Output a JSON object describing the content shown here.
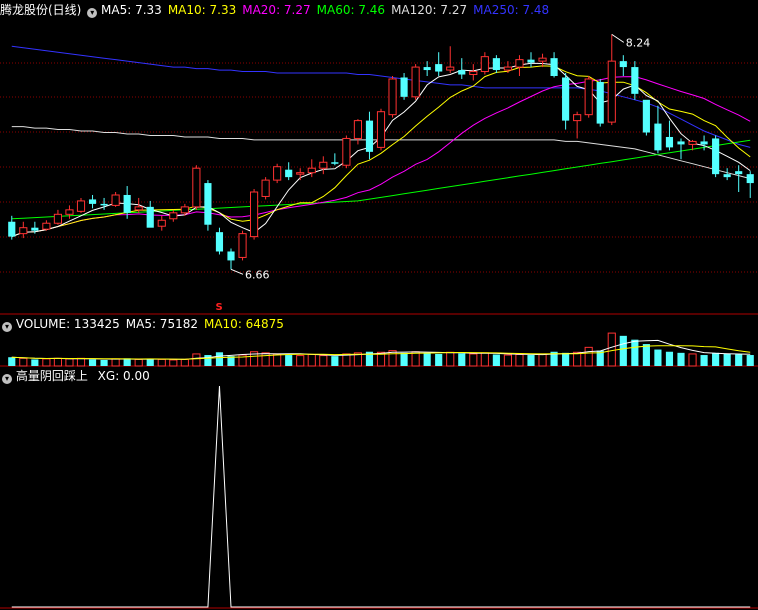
{
  "header": {
    "stock": "腾龙股份(日线)",
    "ma_items": [
      {
        "text": "MA5: 7.33",
        "color": "#ffffff"
      },
      {
        "text": "MA10: 7.33",
        "color": "#ffff00"
      },
      {
        "text": "MA20: 7.27",
        "color": "#ff00ff"
      },
      {
        "text": "MA60: 7.46",
        "color": "#00ff00"
      },
      {
        "text": "MA120: 7.27",
        "color": "#dddddd"
      },
      {
        "text": "MA250: 7.48",
        "color": "#3333ff"
      }
    ]
  },
  "volume_header": {
    "items": [
      {
        "text": "VOLUME: 133425",
        "color": "#ffffff"
      },
      {
        "text": "MA5: 75182",
        "color": "#ffffff"
      },
      {
        "text": "MA10: 64875",
        "color": "#ffff00"
      }
    ]
  },
  "indicator_header": {
    "name": "高量阴回踩上",
    "value": "XG: 0.00"
  },
  "colors": {
    "up": "#ff3232",
    "down": "#54ffff",
    "ma5": "#ffffff",
    "ma10": "#ffff00",
    "ma20": "#ff00ff",
    "ma60": "#00ff00",
    "ma120": "#dddddd",
    "ma250": "#3333ff",
    "grid": "#8b0000"
  },
  "chart_data": {
    "type": "candlestick",
    "price_axis": {
      "min": 6.4,
      "max": 8.35
    },
    "annotations": [
      {
        "text": "8.24",
        "kind": "high"
      },
      {
        "text": "6.66",
        "kind": "low"
      },
      {
        "text": "S",
        "kind": "signal",
        "index": 18
      }
    ],
    "candles": [
      {
        "o": 6.98,
        "h": 7.02,
        "l": 6.86,
        "c": 6.88
      },
      {
        "o": 6.9,
        "h": 6.98,
        "l": 6.87,
        "c": 6.94
      },
      {
        "o": 6.94,
        "h": 6.98,
        "l": 6.9,
        "c": 6.92
      },
      {
        "o": 6.93,
        "h": 6.99,
        "l": 6.92,
        "c": 6.97
      },
      {
        "o": 6.97,
        "h": 7.06,
        "l": 6.96,
        "c": 7.03
      },
      {
        "o": 7.03,
        "h": 7.09,
        "l": 7.0,
        "c": 7.06
      },
      {
        "o": 7.05,
        "h": 7.14,
        "l": 7.04,
        "c": 7.12
      },
      {
        "o": 7.13,
        "h": 7.16,
        "l": 7.07,
        "c": 7.1
      },
      {
        "o": 7.1,
        "h": 7.14,
        "l": 7.06,
        "c": 7.09
      },
      {
        "o": 7.09,
        "h": 7.18,
        "l": 7.08,
        "c": 7.16
      },
      {
        "o": 7.16,
        "h": 7.22,
        "l": 7.0,
        "c": 7.04
      },
      {
        "o": 7.06,
        "h": 7.14,
        "l": 7.04,
        "c": 7.08
      },
      {
        "o": 7.08,
        "h": 7.12,
        "l": 7.0,
        "c": 6.94
      },
      {
        "o": 6.95,
        "h": 7.02,
        "l": 6.92,
        "c": 6.99
      },
      {
        "o": 7.0,
        "h": 7.06,
        "l": 6.98,
        "c": 7.04
      },
      {
        "o": 7.04,
        "h": 7.1,
        "l": 7.02,
        "c": 7.08
      },
      {
        "o": 7.08,
        "h": 7.36,
        "l": 7.06,
        "c": 7.34
      },
      {
        "o": 7.24,
        "h": 7.26,
        "l": 6.92,
        "c": 6.96
      },
      {
        "o": 6.91,
        "h": 6.94,
        "l": 6.76,
        "c": 6.78
      },
      {
        "o": 6.78,
        "h": 6.8,
        "l": 6.66,
        "c": 6.72
      },
      {
        "o": 6.74,
        "h": 6.92,
        "l": 6.72,
        "c": 6.9
      },
      {
        "o": 6.88,
        "h": 7.2,
        "l": 6.86,
        "c": 7.18
      },
      {
        "o": 7.15,
        "h": 7.28,
        "l": 7.13,
        "c": 7.26
      },
      {
        "o": 7.26,
        "h": 7.37,
        "l": 7.24,
        "c": 7.35
      },
      {
        "o": 7.33,
        "h": 7.38,
        "l": 7.26,
        "c": 7.28
      },
      {
        "o": 7.3,
        "h": 7.34,
        "l": 7.26,
        "c": 7.31
      },
      {
        "o": 7.31,
        "h": 7.4,
        "l": 7.28,
        "c": 7.34
      },
      {
        "o": 7.34,
        "h": 7.42,
        "l": 7.3,
        "c": 7.38
      },
      {
        "o": 7.38,
        "h": 7.44,
        "l": 7.36,
        "c": 7.37
      },
      {
        "o": 7.36,
        "h": 7.56,
        "l": 7.34,
        "c": 7.54
      },
      {
        "o": 7.54,
        "h": 7.67,
        "l": 7.5,
        "c": 7.66
      },
      {
        "o": 7.66,
        "h": 7.72,
        "l": 7.4,
        "c": 7.45
      },
      {
        "o": 7.48,
        "h": 7.74,
        "l": 7.46,
        "c": 7.72
      },
      {
        "o": 7.7,
        "h": 7.96,
        "l": 7.68,
        "c": 7.94
      },
      {
        "o": 7.95,
        "h": 7.98,
        "l": 7.8,
        "c": 7.82
      },
      {
        "o": 7.82,
        "h": 8.04,
        "l": 7.8,
        "c": 8.02
      },
      {
        "o": 8.02,
        "h": 8.06,
        "l": 7.96,
        "c": 8.0
      },
      {
        "o": 8.04,
        "h": 8.12,
        "l": 7.96,
        "c": 7.99
      },
      {
        "o": 8.0,
        "h": 8.16,
        "l": 7.98,
        "c": 8.02
      },
      {
        "o": 8.0,
        "h": 8.08,
        "l": 7.94,
        "c": 7.97
      },
      {
        "o": 7.97,
        "h": 8.04,
        "l": 7.93,
        "c": 7.99
      },
      {
        "o": 7.99,
        "h": 8.12,
        "l": 7.97,
        "c": 8.09
      },
      {
        "o": 8.08,
        "h": 8.1,
        "l": 7.98,
        "c": 8.0
      },
      {
        "o": 8.0,
        "h": 8.06,
        "l": 7.98,
        "c": 8.02
      },
      {
        "o": 8.02,
        "h": 8.1,
        "l": 7.96,
        "c": 8.07
      },
      {
        "o": 8.07,
        "h": 8.12,
        "l": 8.02,
        "c": 8.05
      },
      {
        "o": 8.06,
        "h": 8.11,
        "l": 8.02,
        "c": 8.08
      },
      {
        "o": 8.08,
        "h": 8.12,
        "l": 7.95,
        "c": 7.96
      },
      {
        "o": 7.95,
        "h": 7.98,
        "l": 7.6,
        "c": 7.66
      },
      {
        "o": 7.66,
        "h": 7.72,
        "l": 7.54,
        "c": 7.7
      },
      {
        "o": 7.7,
        "h": 7.96,
        "l": 7.68,
        "c": 7.94
      },
      {
        "o": 7.92,
        "h": 7.94,
        "l": 7.62,
        "c": 7.64
      },
      {
        "o": 7.65,
        "h": 8.24,
        "l": 7.63,
        "c": 8.06
      },
      {
        "o": 8.06,
        "h": 8.1,
        "l": 7.96,
        "c": 8.02
      },
      {
        "o": 8.02,
        "h": 8.06,
        "l": 7.8,
        "c": 7.84
      },
      {
        "o": 7.8,
        "h": 7.78,
        "l": 7.56,
        "c": 7.58
      },
      {
        "o": 7.64,
        "h": 7.76,
        "l": 7.44,
        "c": 7.46
      },
      {
        "o": 7.55,
        "h": 7.66,
        "l": 7.46,
        "c": 7.48
      },
      {
        "o": 7.52,
        "h": 7.54,
        "l": 7.4,
        "c": 7.5
      },
      {
        "o": 7.5,
        "h": 7.53,
        "l": 7.46,
        "c": 7.52
      },
      {
        "o": 7.52,
        "h": 7.56,
        "l": 7.46,
        "c": 7.5
      },
      {
        "o": 7.54,
        "h": 7.56,
        "l": 7.28,
        "c": 7.3
      },
      {
        "o": 7.3,
        "h": 7.34,
        "l": 7.26,
        "c": 7.28
      },
      {
        "o": 7.32,
        "h": 7.36,
        "l": 7.18,
        "c": 7.3
      },
      {
        "o": 7.3,
        "h": 7.32,
        "l": 7.14,
        "c": 7.24
      }
    ],
    "volume": [
      16,
      14,
      12,
      13,
      14,
      13,
      14,
      12,
      11,
      13,
      14,
      12,
      13,
      12,
      11,
      12,
      22,
      20,
      25,
      18,
      20,
      26,
      24,
      22,
      20,
      19,
      21,
      19,
      18,
      22,
      24,
      26,
      25,
      28,
      24,
      26,
      24,
      22,
      25,
      23,
      22,
      24,
      21,
      20,
      21,
      20,
      22,
      26,
      24,
      25,
      34,
      28,
      60,
      55,
      48,
      40,
      30,
      26,
      24,
      22,
      20,
      24,
      22,
      21,
      20
    ],
    "xg": [
      0,
      0,
      0,
      0,
      0,
      0,
      0,
      0,
      0,
      0,
      0,
      0,
      0,
      0,
      0,
      0,
      0,
      0,
      1,
      0,
      0,
      0,
      0,
      0,
      0,
      0,
      0,
      0,
      0,
      0,
      0,
      0,
      0,
      0,
      0,
      0,
      0,
      0,
      0,
      0,
      0,
      0,
      0,
      0,
      0,
      0,
      0,
      0,
      0,
      0,
      0,
      0,
      0,
      0,
      0,
      0,
      0,
      0,
      0,
      0,
      0,
      0,
      0,
      0,
      0
    ],
    "ma120": [
      7.62,
      7.62,
      7.61,
      7.61,
      7.6,
      7.6,
      7.59,
      7.59,
      7.58,
      7.58,
      7.57,
      7.57,
      7.56,
      7.56,
      7.56,
      7.55,
      7.55,
      7.55,
      7.54,
      7.54,
      7.54,
      7.53,
      7.53,
      7.53,
      7.53,
      7.53,
      7.53,
      7.53,
      7.53,
      7.53,
      7.53,
      7.53,
      7.53,
      7.53,
      7.53,
      7.53,
      7.53,
      7.53,
      7.53,
      7.53,
      7.53,
      7.53,
      7.53,
      7.53,
      7.53,
      7.53,
      7.53,
      7.53,
      7.52,
      7.52,
      7.51,
      7.5,
      7.49,
      7.48,
      7.47,
      7.45,
      7.43,
      7.41,
      7.39,
      7.37,
      7.35,
      7.33,
      7.31,
      7.29,
      7.27
    ],
    "ma250": [
      8.16,
      8.15,
      8.14,
      8.13,
      8.12,
      8.11,
      8.1,
      8.09,
      8.08,
      8.07,
      8.06,
      8.05,
      8.04,
      8.03,
      8.02,
      8.02,
      8.01,
      8.01,
      8.0,
      8.0,
      7.99,
      7.99,
      7.99,
      7.98,
      7.98,
      7.98,
      7.98,
      7.98,
      7.98,
      7.98,
      7.97,
      7.97,
      7.96,
      7.95,
      7.94,
      7.93,
      7.92,
      7.91,
      7.9,
      7.9,
      7.89,
      7.88,
      7.88,
      7.88,
      7.88,
      7.88,
      7.88,
      7.88,
      7.88,
      7.88,
      7.87,
      7.86,
      7.84,
      7.82,
      7.8,
      7.78,
      7.75,
      7.71,
      7.67,
      7.63,
      7.59,
      7.56,
      7.53,
      7.5,
      7.48
    ]
  }
}
